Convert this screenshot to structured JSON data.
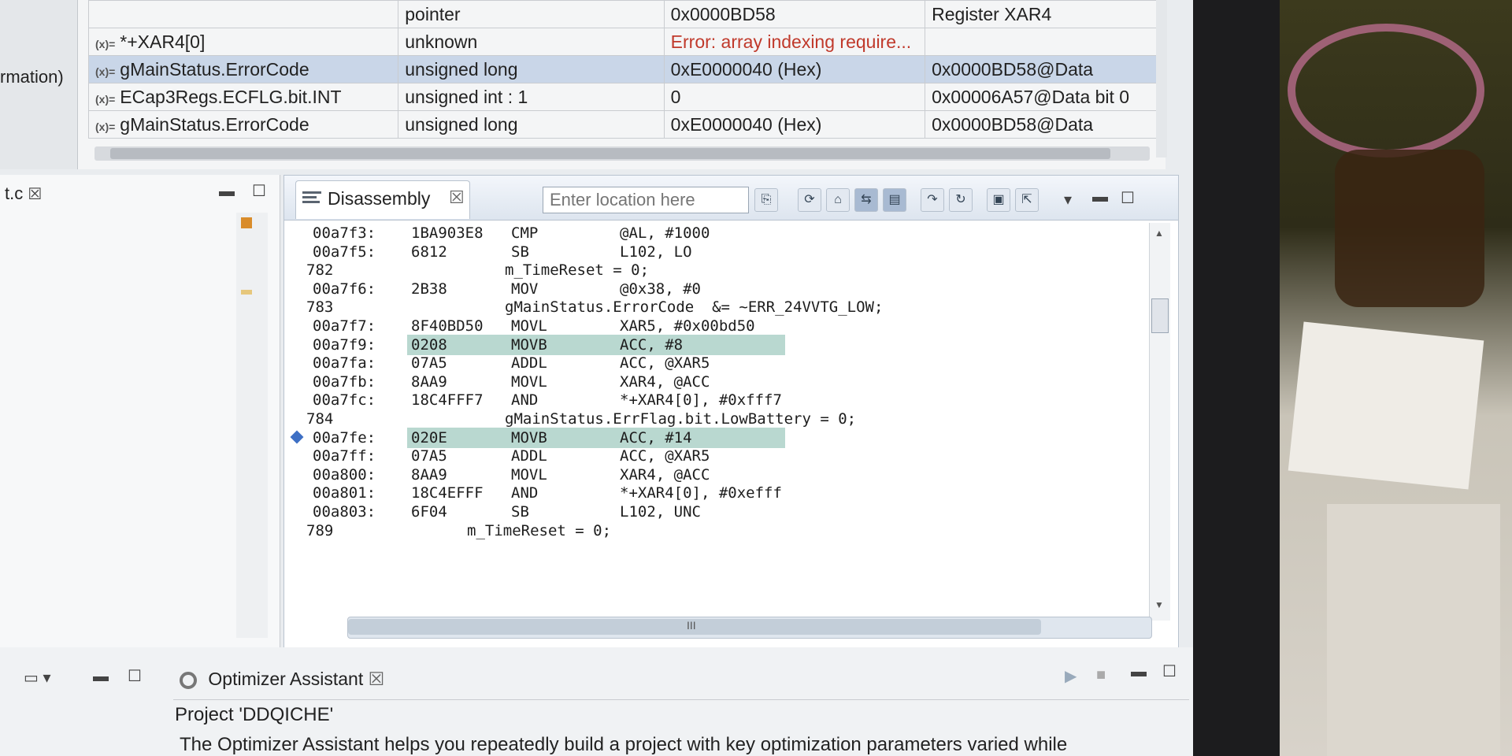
{
  "variables": {
    "partial_left_label": "rmation)",
    "rows": [
      {
        "expression": "",
        "type": "pointer",
        "value": "0x0000BD58",
        "location": "Register XAR4",
        "selected": false
      },
      {
        "expression": "*+XAR4[0]",
        "type": "unknown",
        "value": "Error: array indexing require...",
        "location": "",
        "selected": false,
        "error": true
      },
      {
        "expression": "gMainStatus.ErrorCode",
        "type": "unsigned long",
        "value": "0xE0000040 (Hex)",
        "location": "0x0000BD58@Data",
        "selected": true
      },
      {
        "expression": "ECap3Regs.ECFLG.bit.INT",
        "type": "unsigned int : 1",
        "value": "0",
        "location": "0x00006A57@Data bit 0",
        "selected": false
      },
      {
        "expression": "gMainStatus.ErrorCode",
        "type": "unsigned long",
        "value": "0xE0000040 (Hex)",
        "location": "0x0000BD58@Data",
        "selected": false
      }
    ],
    "expr_icon": "(x)="
  },
  "editor_left": {
    "tab_label": "t.c",
    "close_icon": "close-icon"
  },
  "disassembly": {
    "tab_label": "Disassembly",
    "location_placeholder": "Enter location here",
    "scroll_marker": "III",
    "lines": [
      {
        "addr": "00a7f3:",
        "opcode": "1BA903E8",
        "mnem": "CMP",
        "operands": "@AL, #1000"
      },
      {
        "addr": "00a7f5:",
        "opcode": "6812",
        "mnem": "SB",
        "operands": "L102, LO"
      },
      {
        "src_no": "782",
        "source": "m_TimeReset = 0;"
      },
      {
        "addr": "00a7f6:",
        "opcode": "2B38",
        "mnem": "MOV",
        "operands": "@0x38, #0"
      },
      {
        "src_no": "783",
        "source": "gMainStatus.ErrorCode  &= ~ERR_24VVTG_LOW;"
      },
      {
        "addr": "00a7f7:",
        "opcode": "8F40BD50",
        "mnem": "MOVL",
        "operands": "XAR5, #0x00bd50"
      },
      {
        "addr": "00a7f9:",
        "opcode": "0208",
        "mnem": "MOVB",
        "operands": "ACC, #8",
        "highlight": true
      },
      {
        "addr": "00a7fa:",
        "opcode": "07A5",
        "mnem": "ADDL",
        "operands": "ACC, @XAR5"
      },
      {
        "addr": "00a7fb:",
        "opcode": "8AA9",
        "mnem": "MOVL",
        "operands": "XAR4, @ACC"
      },
      {
        "addr": "00a7fc:",
        "opcode": "18C4FFF7",
        "mnem": "AND",
        "operands": "*+XAR4[0], #0xfff7"
      },
      {
        "src_no": "784",
        "source": "gMainStatus.ErrFlag.bit.LowBattery = 0;"
      },
      {
        "addr": "00a7fe:",
        "opcode": "020E",
        "mnem": "MOVB",
        "operands": "ACC, #14",
        "highlight": true,
        "current": true
      },
      {
        "addr": "00a7ff:",
        "opcode": "07A5",
        "mnem": "ADDL",
        "operands": "ACC, @XAR5"
      },
      {
        "addr": "00a800:",
        "opcode": "8AA9",
        "mnem": "MOVL",
        "operands": "XAR4, @ACC"
      },
      {
        "addr": "00a801:",
        "opcode": "18C4EFFF",
        "mnem": "AND",
        "operands": "*+XAR4[0], #0xefff"
      },
      {
        "addr": "00a803:",
        "opcode": "6F04",
        "mnem": "SB",
        "operands": "L102, UNC"
      },
      {
        "src_no": "789",
        "source": "m_TimeReset = 0;",
        "source_indent": "short"
      }
    ]
  },
  "optimizer": {
    "tab_label": "Optimizer Assistant",
    "project": "Project 'DDQICHE'",
    "description": "The Optimizer Assistant helps you repeatedly build a project with key optimization parameters varied while"
  }
}
